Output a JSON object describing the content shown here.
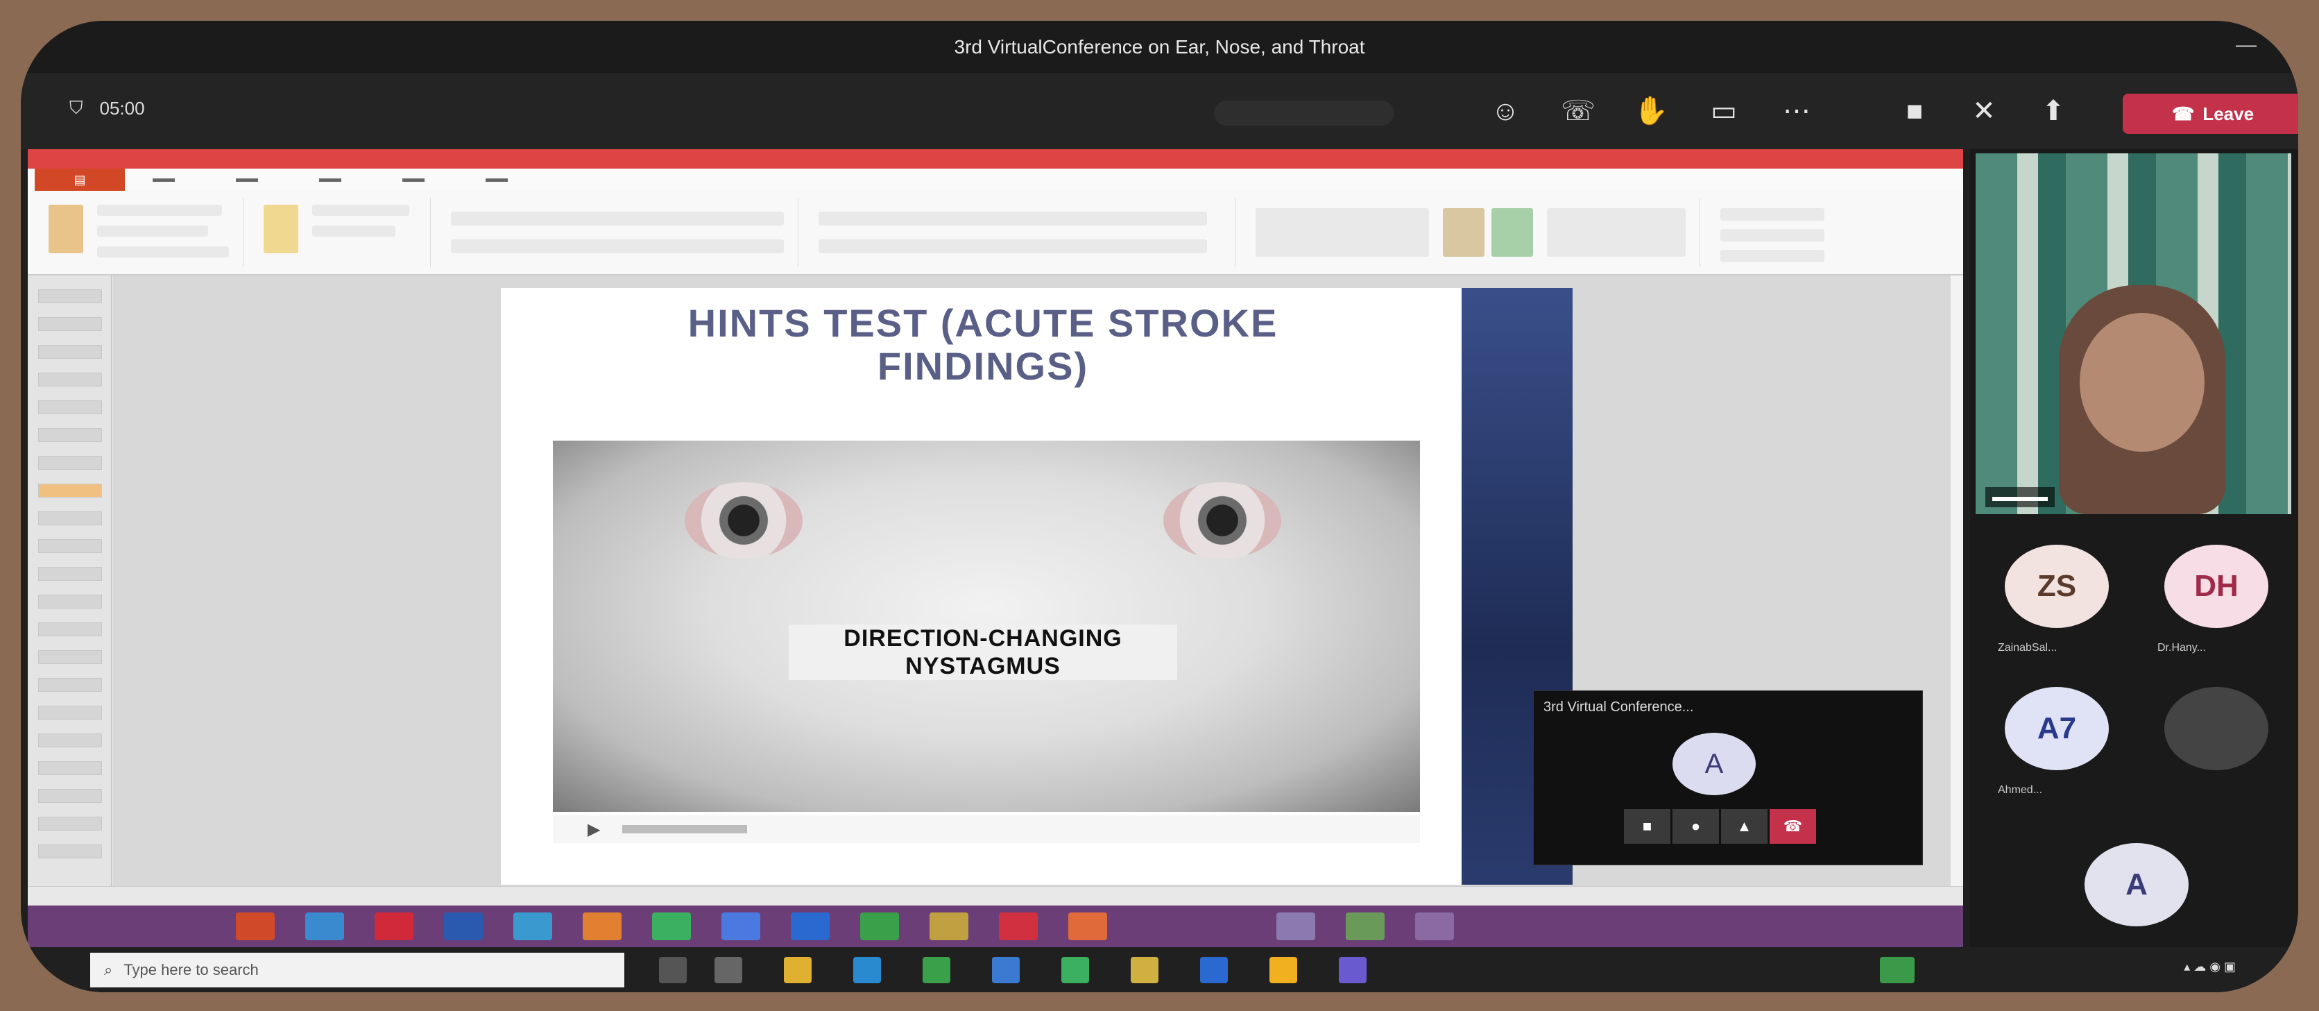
{
  "window": {
    "title": "3rd VirtualConference on Ear, Nose, and Throat"
  },
  "meeting_toolbar": {
    "timer": "05:00",
    "leave_label": "Leave"
  },
  "slide": {
    "heading_line1": "HINTS TEST (ACUTE STROKE",
    "heading_line2": "FINDINGS)",
    "video_caption_line1": "DIRECTION-CHANGING",
    "video_caption_line2": "NYSTAGMUS"
  },
  "mini_window": {
    "title": "3rd Virtual Conference...",
    "avatar_initial": "A"
  },
  "participants": [
    {
      "initials": "ZS",
      "name": "ZainabSal...",
      "bg": "#f3e3e0",
      "fg": "#5a3a2a"
    },
    {
      "initials": "DH",
      "name": "Dr.Hany...",
      "bg": "#f6dde6",
      "fg": "#a02a4a"
    },
    {
      "initials": "A7",
      "name": "Ahmed...",
      "bg": "#dfe3f5",
      "fg": "#2a3a8a"
    },
    {
      "initials": "",
      "name": "",
      "bg": "#444444",
      "fg": "#777777"
    }
  ],
  "bottom_participant": {
    "initials": "A"
  },
  "win_taskbar": {
    "search_placeholder": "Type here to search"
  },
  "colors": {
    "leave": "#c4314b",
    "ppt_accent": "#d24726",
    "taskbar_purple": "#6b3e78"
  }
}
